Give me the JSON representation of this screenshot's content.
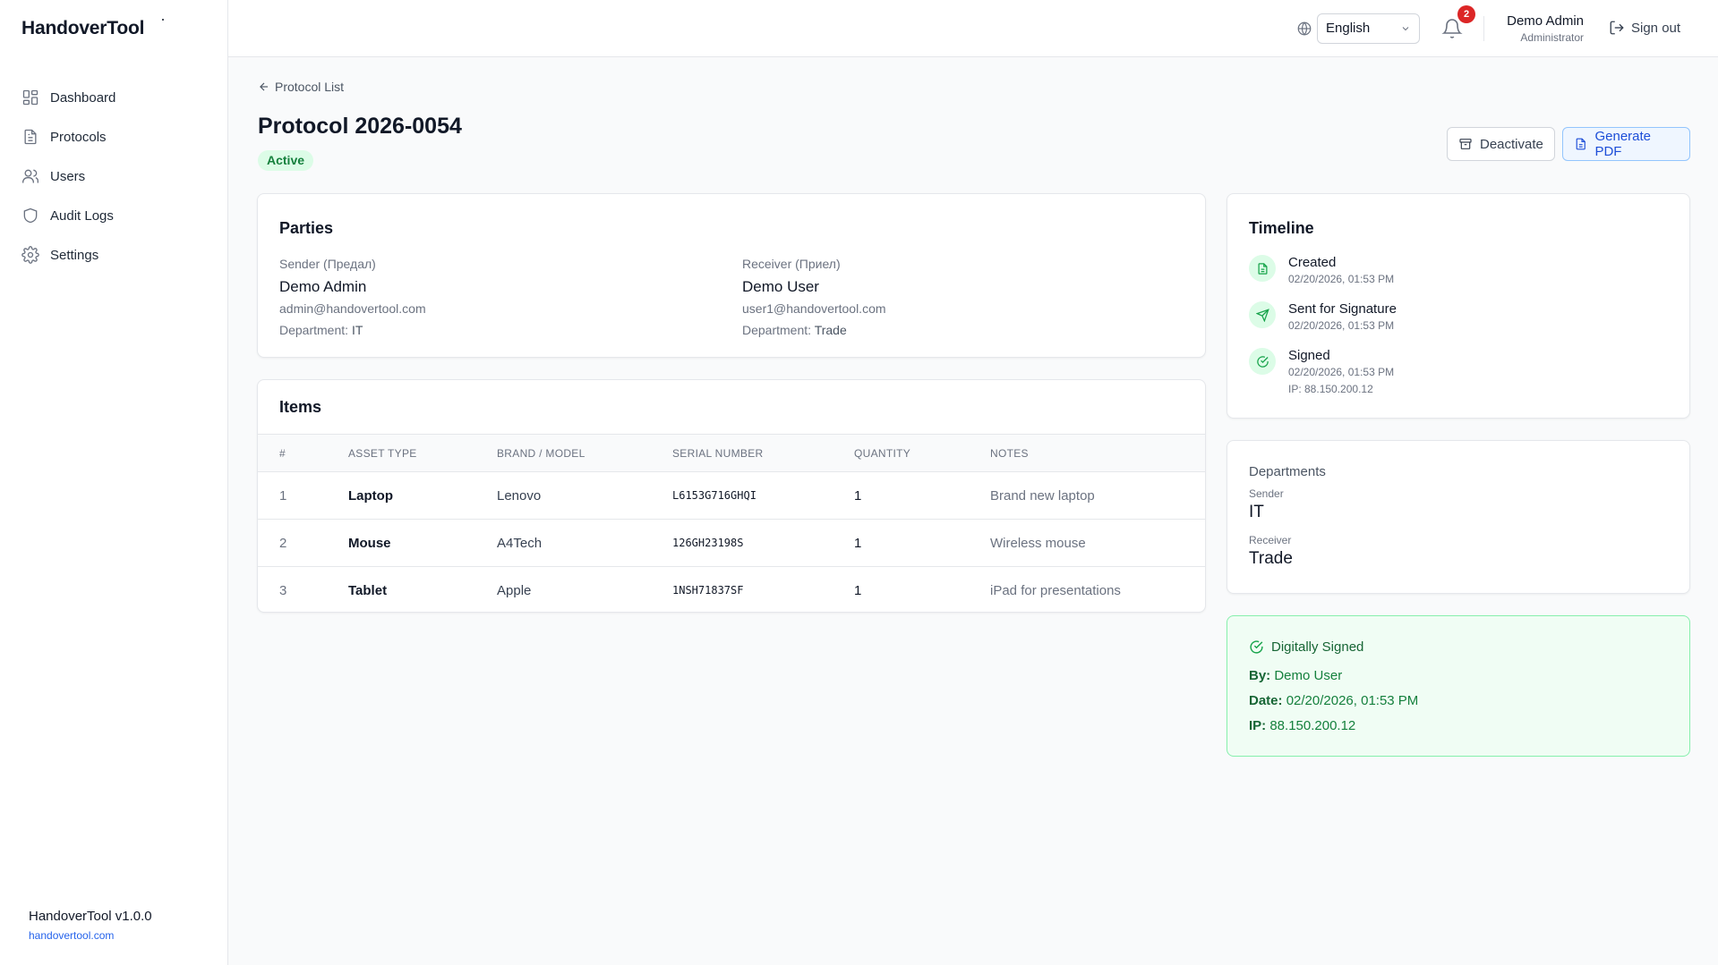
{
  "app": {
    "name": "HandoverTool",
    "version": "HandoverTool v1.0.0",
    "site": "handovertool.com"
  },
  "sidebar": {
    "items": [
      {
        "label": "Dashboard",
        "icon": "dashboard-icon"
      },
      {
        "label": "Protocols",
        "icon": "document-icon"
      },
      {
        "label": "Users",
        "icon": "users-icon"
      },
      {
        "label": "Audit Logs",
        "icon": "shield-icon"
      },
      {
        "label": "Settings",
        "icon": "gear-icon"
      }
    ]
  },
  "header": {
    "language": "English",
    "notification_count": "2",
    "user_name": "Demo Admin",
    "user_role": "Administrator",
    "sign_out": "Sign out"
  },
  "page": {
    "back_label": "Protocol List",
    "title": "Protocol 2026-0054",
    "status": "Active",
    "deactivate_label": "Deactivate",
    "generate_pdf_label": "Generate PDF"
  },
  "parties": {
    "title": "Parties",
    "sender": {
      "label": "Sender (Предал)",
      "name": "Demo Admin",
      "email": "admin@handovertool.com",
      "dept_label": "Department:",
      "dept": "IT"
    },
    "receiver": {
      "label": "Receiver (Приел)",
      "name": "Demo User",
      "email": "user1@handovertool.com",
      "dept_label": "Department:",
      "dept": "Trade"
    }
  },
  "items": {
    "title": "Items",
    "columns": [
      "#",
      "ASSET TYPE",
      "BRAND / MODEL",
      "SERIAL NUMBER",
      "QUANTITY",
      "NOTES"
    ],
    "rows": [
      {
        "n": "1",
        "type": "Laptop",
        "brand": "Lenovo",
        "serial": "L6153G716GHQI",
        "qty": "1",
        "notes": "Brand new laptop"
      },
      {
        "n": "2",
        "type": "Mouse",
        "brand": "A4Tech",
        "serial": "126GH23198S",
        "qty": "1",
        "notes": "Wireless mouse"
      },
      {
        "n": "3",
        "type": "Tablet",
        "brand": "Apple",
        "serial": "1NSH71837SF",
        "qty": "1",
        "notes": "iPad for presentations"
      }
    ]
  },
  "timeline": {
    "title": "Timeline",
    "events": [
      {
        "label": "Created",
        "date": "02/20/2026, 01:53 PM",
        "icon": "document-icon"
      },
      {
        "label": "Sent for Signature",
        "date": "02/20/2026, 01:53 PM",
        "icon": "send-icon"
      },
      {
        "label": "Signed",
        "date": "02/20/2026, 01:53 PM",
        "ip": "IP: 88.150.200.12",
        "icon": "check-circle-icon"
      }
    ]
  },
  "departments": {
    "title": "Departments",
    "sender_label": "Sender",
    "sender": "IT",
    "receiver_label": "Receiver",
    "receiver": "Trade"
  },
  "signature": {
    "title": "Digitally Signed",
    "by_label": "By:",
    "by": "Demo User",
    "date_label": "Date:",
    "date": "02/20/2026, 01:53 PM",
    "ip_label": "IP:",
    "ip": "88.150.200.12"
  },
  "colors": {
    "primary": "#2563eb",
    "success": "#16a34a",
    "danger": "#dc2626"
  }
}
